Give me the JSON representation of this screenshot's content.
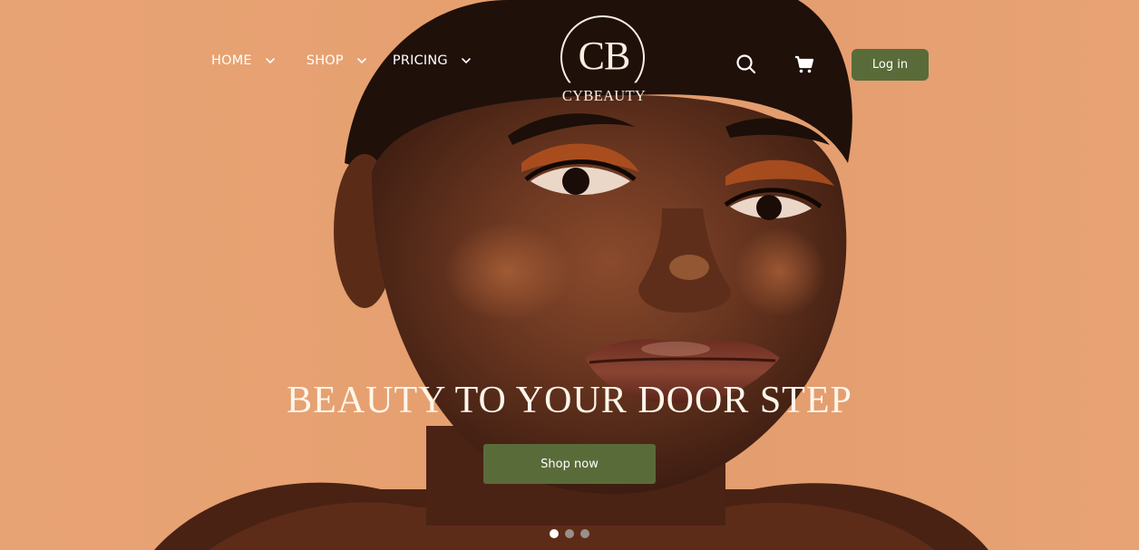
{
  "brand": {
    "monogram": "CB",
    "wordmark": "CYBEAUTY"
  },
  "nav": {
    "items": [
      {
        "label": "HOME",
        "icon": "chevron-down-icon"
      },
      {
        "label": "SHOP",
        "icon": "chevron-down-icon"
      },
      {
        "label": "PRICING",
        "icon": "chevron-down-icon"
      }
    ]
  },
  "header": {
    "search_icon": "search-icon",
    "cart_icon": "cart-icon",
    "login_label": "Log in"
  },
  "hero": {
    "headline": "BEAUTY TO YOUR DOOR STEP",
    "cta_label": "Shop now",
    "slides": 3,
    "active_slide": 1
  },
  "colors": {
    "background": "#e8a072",
    "accent": "#5a6b3a",
    "text_light": "#fff6ea"
  }
}
